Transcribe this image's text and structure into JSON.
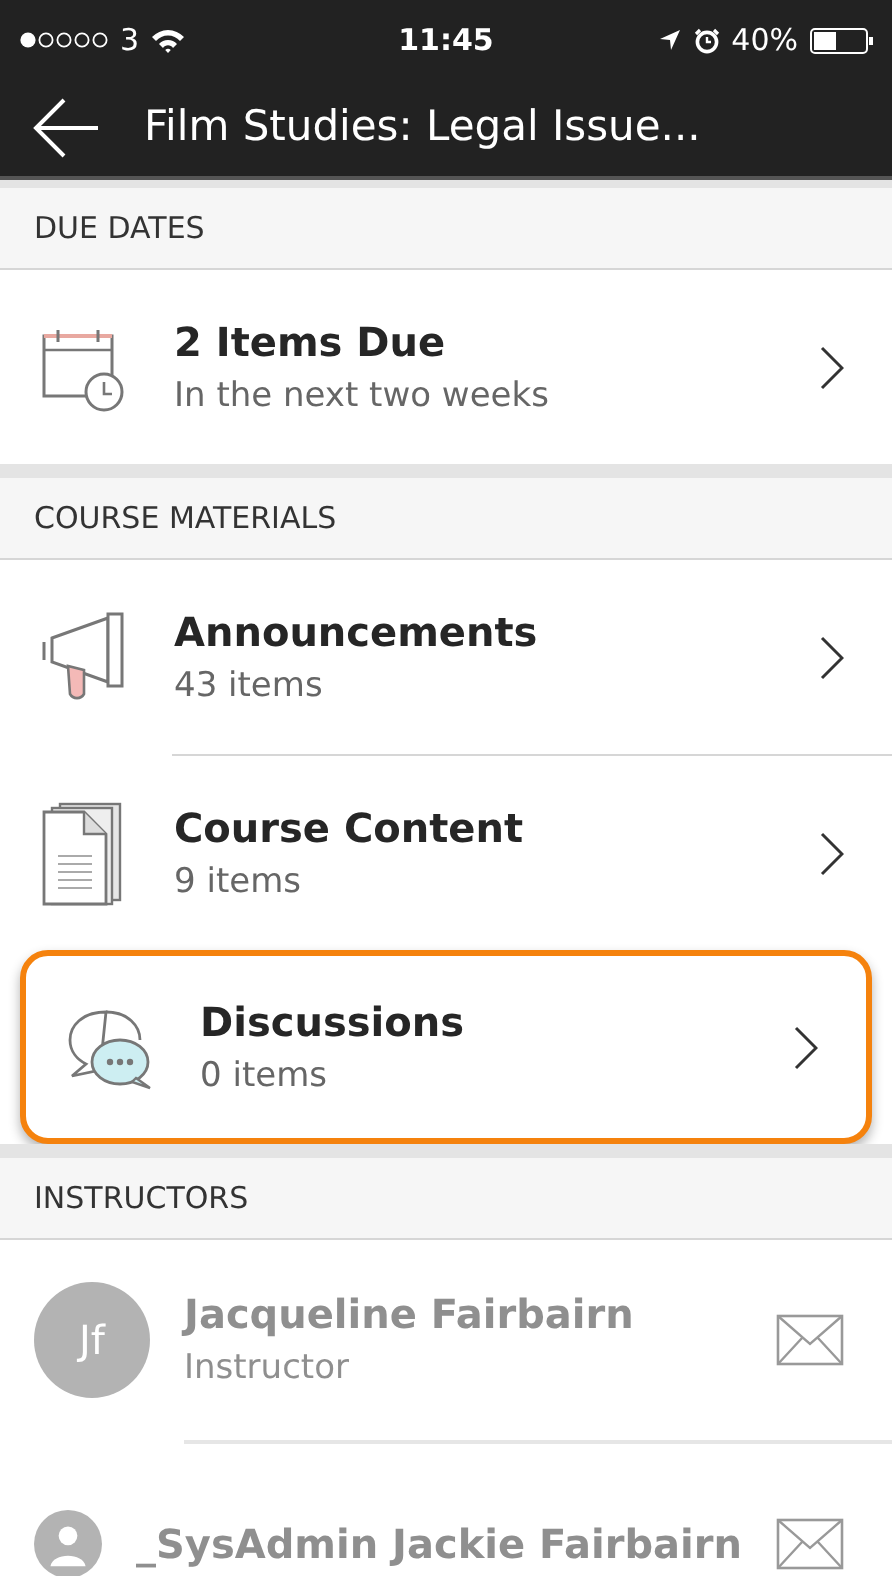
{
  "status_bar": {
    "carrier": "3",
    "time": "11:45",
    "battery": "40%"
  },
  "header": {
    "title": "Film Studies: Legal Issue..."
  },
  "sections": [
    {
      "title": "DUE DATES",
      "kind": "items",
      "items": [
        {
          "kind": "calendar",
          "title": "2 Items Due",
          "subtitle": "In the next two weeks",
          "highlighted": false
        }
      ]
    },
    {
      "title": "COURSE MATERIALS",
      "kind": "items",
      "items": [
        {
          "kind": "megaphone",
          "title": "Announcements",
          "subtitle": "43 items",
          "highlighted": false
        },
        {
          "kind": "document",
          "title": "Course Content",
          "subtitle": "9 items",
          "highlighted": false
        },
        {
          "kind": "chat",
          "title": "Discussions",
          "subtitle": "0 items",
          "highlighted": true
        }
      ]
    },
    {
      "title": "INSTRUCTORS",
      "kind": "people",
      "items": [
        {
          "kind": "initials",
          "initials": "Jf",
          "name": "Jacqueline Fairbairn",
          "role": "Instructor"
        },
        {
          "kind": "silhouette",
          "name": "_SysAdmin Jackie Fairbairn"
        }
      ]
    }
  ]
}
